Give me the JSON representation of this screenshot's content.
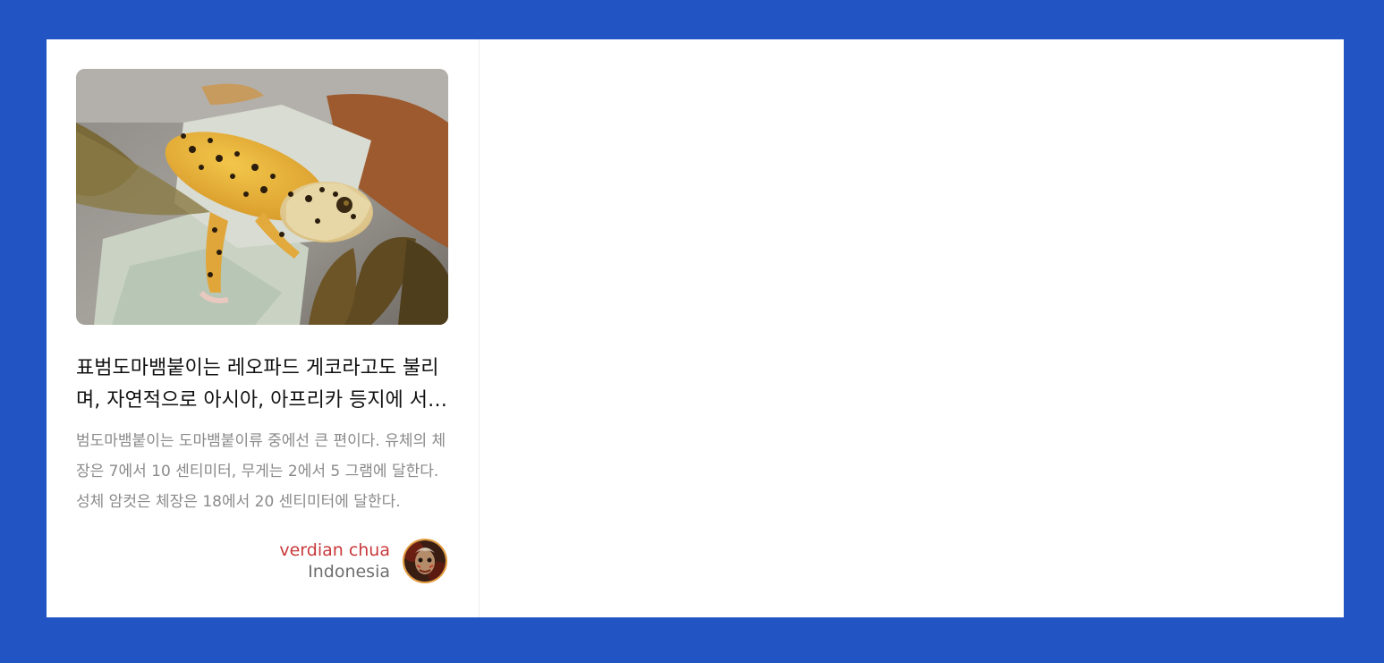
{
  "card": {
    "image_subject": "leopard-gecko-photo",
    "title": "표범도마뱀붙이는 레오파드 게코라고도 불리며, 자연적으로 아시아, 아프리카 등지에 서식한다.",
    "excerpt": "범도마뱀붙이는 도마뱀붙이류 중에선 큰 편이다. 유체의 체장은 7에서 10 센티미터, 무게는 2에서 5 그램에 달한다. 성체 암컷은 체장은 18에서 20 센티미터에 달한다.",
    "author": {
      "name": "verdian chua",
      "country": "Indonesia",
      "avatar_icon": "user-avatar"
    }
  },
  "colors": {
    "background": "#2254c4",
    "panel": "#ffffff",
    "author_name": "#c9393b",
    "author_country": "#6e6e6e",
    "excerpt": "#8a8a8a"
  }
}
